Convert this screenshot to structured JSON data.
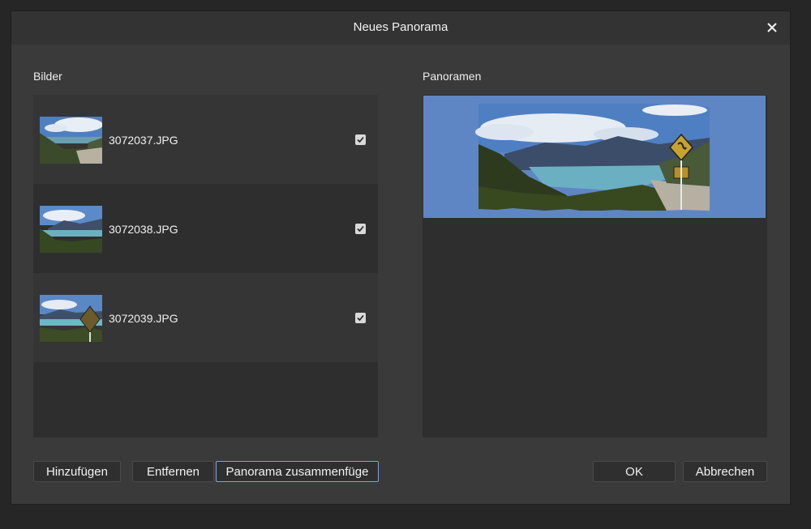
{
  "dialog": {
    "title": "Neues Panorama",
    "close_icon": "close-icon"
  },
  "images_section": {
    "label": "Bilder",
    "items": [
      {
        "filename": "3072037.JPG",
        "checked": true
      },
      {
        "filename": "3072038.JPG",
        "checked": true
      },
      {
        "filename": "3072039.JPG",
        "checked": true
      }
    ]
  },
  "panorama_section": {
    "label": "Panoramen"
  },
  "buttons": {
    "add": "Hinzufügen",
    "remove": "Entfernen",
    "stitch": "Panorama zusammenfüge",
    "ok": "OK",
    "cancel": "Abbrechen"
  },
  "colors": {
    "dialog_bg": "#3a3a3a",
    "panel_bg": "#2e2e2e",
    "panorama_bg": "#5e86c4",
    "focus_border": "#7fa3d6"
  }
}
